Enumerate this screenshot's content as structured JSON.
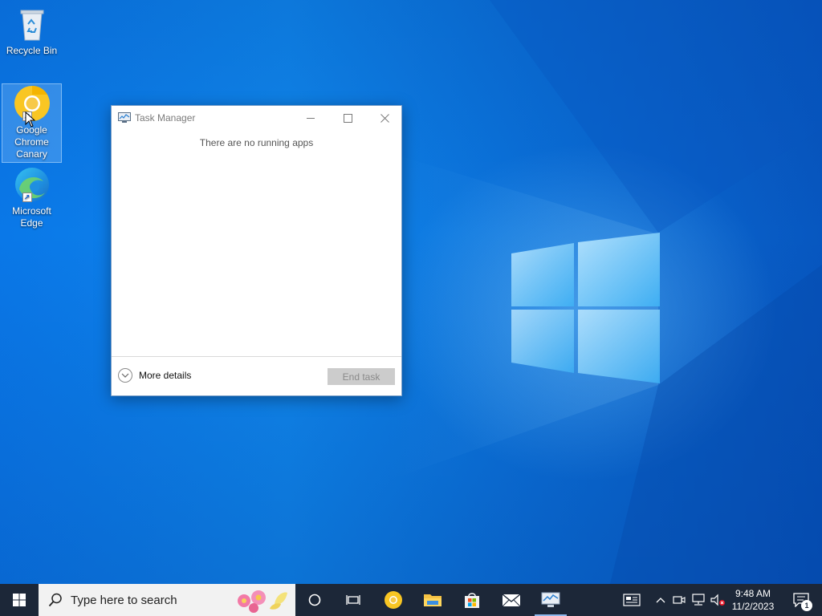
{
  "desktop": {
    "icons": [
      {
        "label": "Recycle Bin",
        "icon": "recycle-bin-icon"
      },
      {
        "label": "Google Chrome Canary",
        "icon": "chrome-canary-icon"
      },
      {
        "label": "Microsoft Edge",
        "icon": "edge-icon"
      }
    ]
  },
  "task_manager": {
    "title": "Task Manager",
    "empty_message": "There are no running apps",
    "more_details_label": "More details",
    "end_task_label": "End task"
  },
  "taskbar": {
    "search_placeholder": "Type here to search",
    "pinned": [
      "cortana-icon",
      "task-view-icon",
      "chrome-canary-icon",
      "file-explorer-icon",
      "microsoft-store-icon",
      "mail-icon",
      "task-manager-icon"
    ],
    "clock": {
      "time": "9:48 AM",
      "date": "11/2/2023"
    },
    "notifications_count": "1"
  },
  "colors": {
    "taskbar": "#1c2738",
    "accent": "#0a78e8"
  }
}
